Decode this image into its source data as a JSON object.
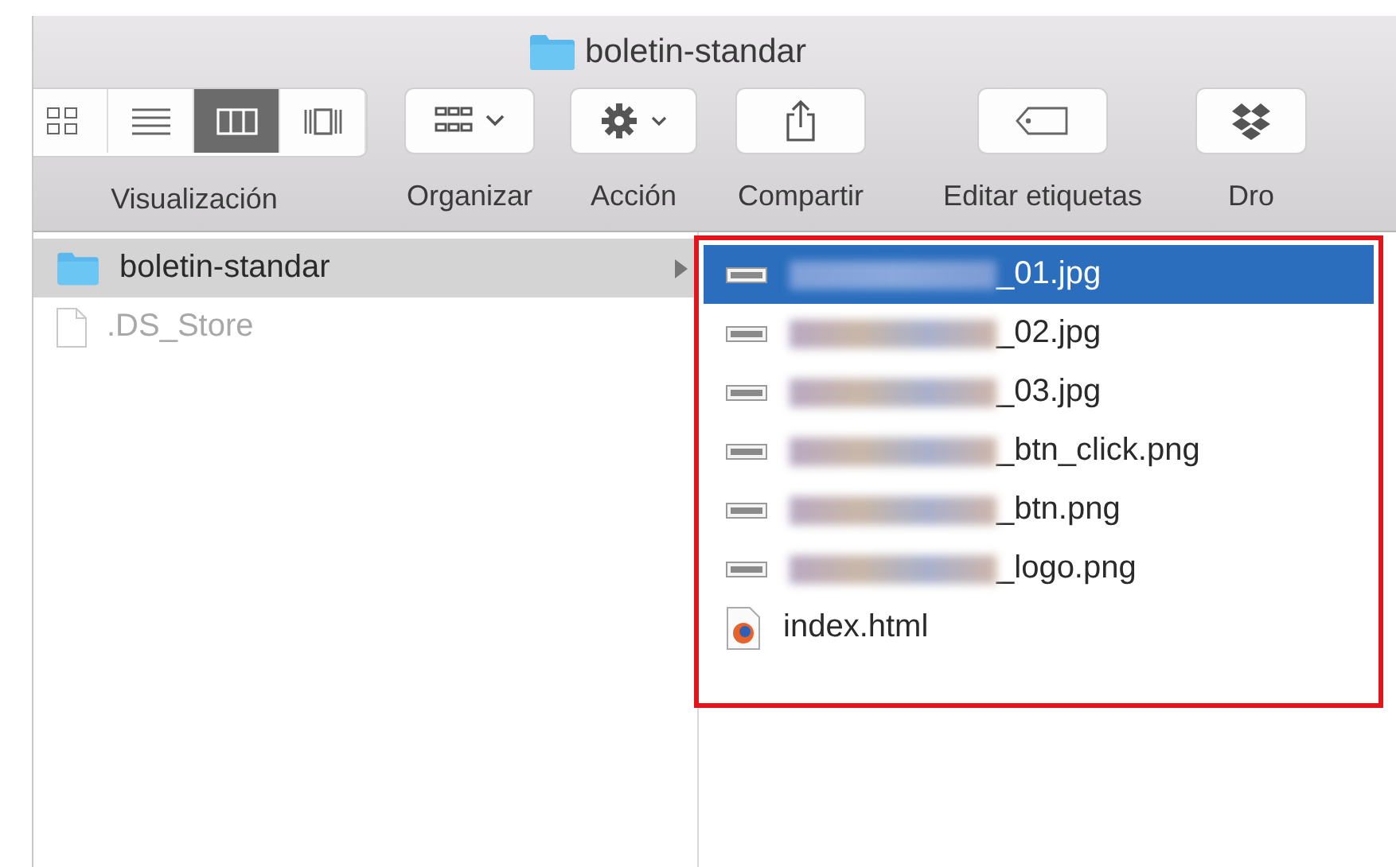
{
  "window": {
    "title": "boletin-standar"
  },
  "toolbar": [
    {
      "kind": "view",
      "label": "Visualización",
      "modes": [
        {
          "selected": false
        },
        {
          "selected": false
        },
        {
          "selected": true
        },
        {
          "selected": false
        }
      ]
    },
    {
      "kind": "arrange",
      "label": "Organizar"
    },
    {
      "kind": "action",
      "label": "Acción"
    },
    {
      "kind": "share",
      "label": "Compartir"
    },
    {
      "kind": "tags",
      "label": "Editar etiquetas"
    },
    {
      "kind": "dropbox",
      "label": "Dro"
    }
  ],
  "column_1": {
    "items": [
      {
        "name": "boletin-standar",
        "kind": "folder",
        "selected": true,
        "dimmed": false
      },
      {
        "name": ".DS_Store",
        "kind": "file",
        "selected": false,
        "dimmed": true
      }
    ]
  },
  "column_2": {
    "highlighted": true,
    "items": [
      {
        "name": "_01.jpg",
        "kind": "image",
        "redacted": true,
        "selected": true
      },
      {
        "name": "_02.jpg",
        "kind": "image",
        "redacted": true,
        "selected": false
      },
      {
        "name": "_03.jpg",
        "kind": "image",
        "redacted": true,
        "selected": false
      },
      {
        "name": "_btn_click.png",
        "kind": "image",
        "redacted": true,
        "selected": false
      },
      {
        "name": "_btn.png",
        "kind": "image",
        "redacted": true,
        "selected": false
      },
      {
        "name": "_logo.png",
        "kind": "image",
        "redacted": true,
        "selected": false
      },
      {
        "name": "index.html",
        "kind": "html",
        "redacted": false,
        "selected": false
      }
    ]
  }
}
